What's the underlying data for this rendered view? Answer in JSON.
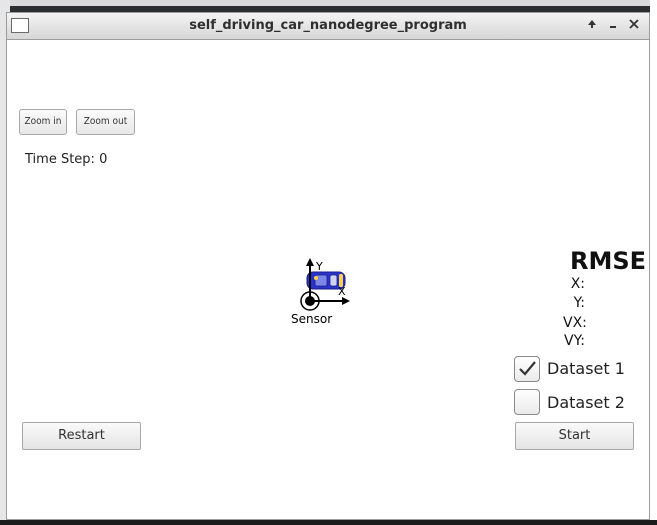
{
  "window": {
    "title": "self_driving_car_nanodegree_program",
    "controls": [
      "up-arrow-icon",
      "minimize-icon",
      "close-icon"
    ]
  },
  "toolbar": {
    "zoom_in_label": "Zoom in",
    "zoom_out_label": "Zoom out"
  },
  "simulation": {
    "time_step_label": "Time Step:",
    "time_step_value": "0",
    "sensor_label": "Sensor",
    "axis_x_label": "X",
    "axis_y_label": "Y",
    "car_color": "#2a33c9"
  },
  "rmse": {
    "title": "RMSE",
    "labels": [
      "X:",
      "Y:",
      "VX:",
      "VY:"
    ]
  },
  "datasets": [
    {
      "label": "Dataset 1",
      "checked": true
    },
    {
      "label": "Dataset 2",
      "checked": false
    }
  ],
  "buttons": {
    "restart_label": "Restart",
    "start_label": "Start"
  }
}
